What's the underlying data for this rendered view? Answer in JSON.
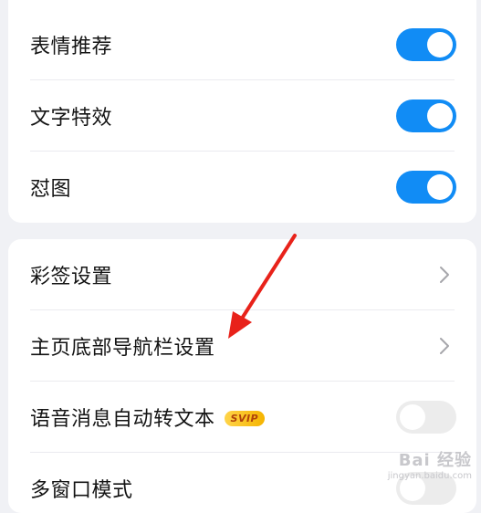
{
  "section_one": {
    "items": [
      {
        "label": "表情推荐",
        "toggle": "on"
      },
      {
        "label": "文字特效",
        "toggle": "on"
      },
      {
        "label": "怼图",
        "toggle": "on"
      }
    ]
  },
  "section_two": {
    "items": [
      {
        "label": "彩签设置",
        "control": "chevron-right-icon"
      },
      {
        "label": "主页底部导航栏设置",
        "control": "chevron-right-icon"
      },
      {
        "label": "语音消息自动转文本",
        "badge": "SVIP",
        "toggle": "off"
      },
      {
        "label": "多窗口模式",
        "toggle": "off"
      }
    ]
  },
  "annotation": {
    "icon": "red-arrow-icon",
    "color": "#e8221a"
  },
  "watermark": {
    "title": "Bai 经验",
    "url": "jingyan.baidu.com"
  },
  "colors": {
    "accent": "#118cf5",
    "toggle_off": "#ececec",
    "background": "#f0f1f5"
  }
}
